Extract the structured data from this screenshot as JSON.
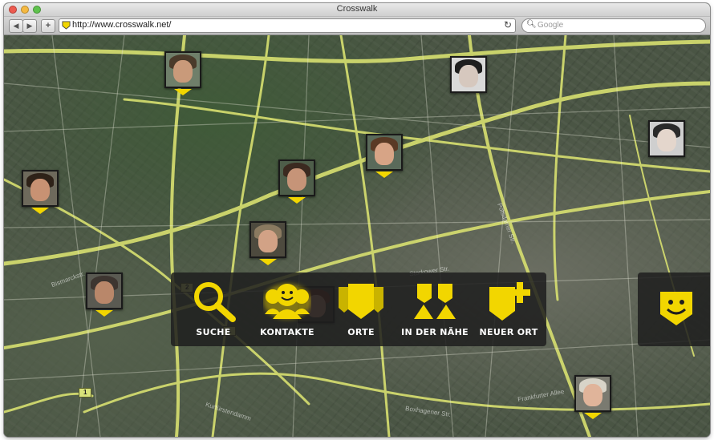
{
  "window": {
    "title": "Crosswalk"
  },
  "toolbar": {
    "back_label": "◀",
    "forward_label": "▶",
    "add_label": "+",
    "url": "http://www.crosswalk.net/",
    "reload_label": "↻",
    "search_placeholder": "Google"
  },
  "colors": {
    "accent": "#f2d600",
    "menu_bg": "#1e1e1e",
    "road": "#d8e070"
  },
  "map": {
    "streets": [
      "Bismarckstr.",
      "Storkower Str.",
      "Frankfurter Allee",
      "Boxhagener Str.",
      "Kurfürstendamm",
      "Potsdamer Str."
    ],
    "route_shields": [
      "1",
      "2",
      "1"
    ]
  },
  "contacts": [
    {
      "name": "contact-1",
      "skin": "#c99a7a",
      "hair": "#4a3a2a",
      "bg": "#6f7f6a"
    },
    {
      "name": "contact-2",
      "skin": "#d6c8be",
      "hair": "#1e1e1e",
      "bg": "#d9d9d9"
    },
    {
      "name": "contact-3",
      "skin": "#d7a486",
      "hair": "#5a3a25",
      "bg": "#5a6a5a"
    },
    {
      "name": "contact-4",
      "skin": "#c69478",
      "hair": "#3b2a20",
      "bg": "#4e5e4a"
    },
    {
      "name": "contact-5",
      "skin": "#d2a286",
      "hair": "#8a7a60",
      "bg": "#4d4a3e"
    },
    {
      "name": "contact-6",
      "skin": "#e4d6cc",
      "hair": "#2a2a2a",
      "bg": "#cfcfcf"
    },
    {
      "name": "contact-7",
      "skin": "#c89273",
      "hair": "#2e2218",
      "bg": "#6e6a5c"
    },
    {
      "name": "contact-8",
      "skin": "#b9876a",
      "hair": "#3d3530",
      "bg": "#5a5a52"
    },
    {
      "name": "contact-9",
      "skin": "#c08a70",
      "hair": "#6e2e20",
      "bg": "#3f3a36"
    },
    {
      "name": "contact-10",
      "skin": "#e0b49a",
      "hair": "#d8d4c8",
      "bg": "#7a7a70"
    }
  ],
  "menu": [
    {
      "label": "Suche",
      "icon": "magnifier-icon"
    },
    {
      "label": "Kontakte",
      "icon": "contacts-icon"
    },
    {
      "label": "Orte",
      "icon": "places-icon"
    },
    {
      "label": "In der Nähe",
      "icon": "nearby-icon"
    },
    {
      "label": "Neuer Ort",
      "icon": "new-place-icon"
    }
  ],
  "logo": {
    "icon": "crosswalk-smiley-icon"
  }
}
